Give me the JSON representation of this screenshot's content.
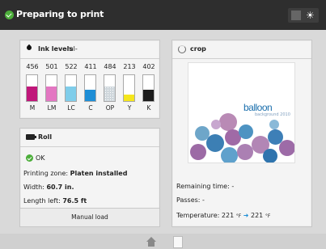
{
  "status": {
    "title": "Preparing to print",
    "display_toggle_icon": "sun-icon"
  },
  "ink": {
    "title": "Ink levels",
    "unit": "-ml-",
    "cartridges": [
      {
        "level": "456",
        "name": "M",
        "color": "#c0177a",
        "fill": 0.55
      },
      {
        "level": "501",
        "name": "LM",
        "color": "#e377c2",
        "fill": 0.55
      },
      {
        "level": "522",
        "name": "LC",
        "color": "#7fcdea",
        "fill": 0.55
      },
      {
        "level": "411",
        "name": "C",
        "color": "#1e8ed6",
        "fill": 0.45
      },
      {
        "level": "484",
        "name": "OP",
        "color": "#cfd7dc",
        "fill": 0.55
      },
      {
        "level": "213",
        "name": "Y",
        "color": "#f5e61c",
        "fill": 0.25
      },
      {
        "level": "402",
        "name": "K",
        "color": "#1c1c1c",
        "fill": 0.45
      }
    ]
  },
  "roll": {
    "title": "Roll",
    "status": "OK",
    "printing_zone_label": "Printing zone:",
    "printing_zone_value": "Platen installed",
    "width_label": "Width:",
    "width_value": "60.7 in.",
    "length_label": "Length left:",
    "length_value": "76.5 ft",
    "button": "Manual load"
  },
  "job": {
    "name": "crop",
    "preview_text": "balloon",
    "preview_subtext": "background 2010",
    "remaining_label": "Remaining time:",
    "remaining_value": "-",
    "passes_label": "Passes:",
    "passes_value": "-",
    "temperature_label": "Temperature:",
    "temp_current": "221",
    "temp_unit": "°F",
    "temp_target": "221"
  }
}
